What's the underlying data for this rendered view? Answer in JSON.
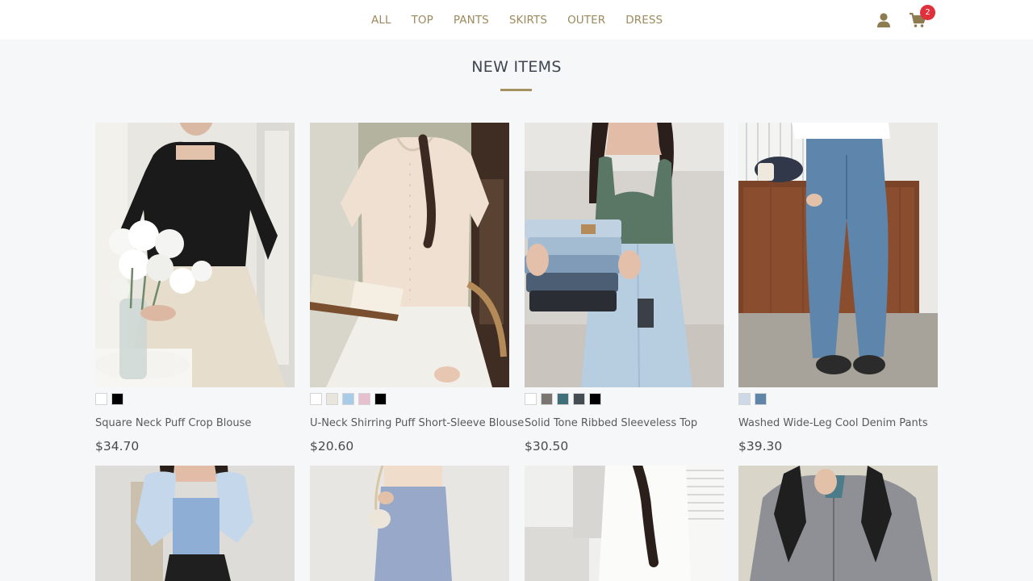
{
  "nav": {
    "items": [
      {
        "label": "ALL"
      },
      {
        "label": "TOP"
      },
      {
        "label": "PANTS"
      },
      {
        "label": "SKIRTS"
      },
      {
        "label": "OUTER"
      },
      {
        "label": "DRESS"
      }
    ],
    "user_icon": "user-icon",
    "cart_icon": "cart-icon",
    "cart_count": "2"
  },
  "section": {
    "title": "NEW ITEMS"
  },
  "colors": {
    "accent": "#a59260",
    "nav_text": "#9c8a5e",
    "badge": "#e0303c",
    "page_bg": "#f6f7f9"
  },
  "products": [
    {
      "name": "Square Neck Puff Crop Blouse",
      "price": "$34.70",
      "swatches": [
        "#ffffff",
        "#000000"
      ]
    },
    {
      "name": "U-Neck Shirring Puff Short-Sleeve Blouse",
      "price": "$20.60",
      "swatches": [
        "#ffffff",
        "#e7e5dc",
        "#a8cbe8",
        "#e7bfcd",
        "#000000"
      ]
    },
    {
      "name": "Solid Tone Ribbed Sleeveless Top",
      "price": "$30.50",
      "swatches": [
        "#ffffff",
        "#7a7570",
        "#3f6f78",
        "#454c54",
        "#000000"
      ]
    },
    {
      "name": "Washed Wide-Leg Cool Denim Pants",
      "price": "$39.30",
      "swatches": [
        "#cdd9e6",
        "#5f86a8"
      ]
    }
  ],
  "second_row": [
    {
      "image": "product-photo"
    },
    {
      "image": "product-photo"
    },
    {
      "image": "product-photo"
    },
    {
      "image": "product-photo"
    }
  ]
}
